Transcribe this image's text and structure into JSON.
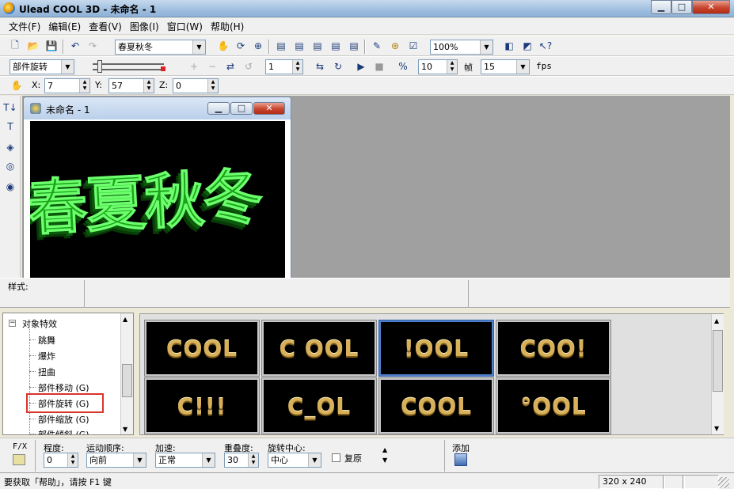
{
  "window": {
    "title": "Ulead COOL 3D - 未命名 - 1",
    "minimize": "▁",
    "maximize": "□",
    "close": "✕"
  },
  "menubar": [
    "文件(F)",
    "编辑(E)",
    "查看(V)",
    "图像(I)",
    "窗口(W)",
    "帮助(H)"
  ],
  "toolbar1": {
    "text_object_combo": "春夏秋冬",
    "zoom_combo": "100%"
  },
  "toolbar2": {
    "object_combo": "部件旋转",
    "frame_value": "1",
    "total_frames_value": "10",
    "frames_label": "帧",
    "fps_value": "15",
    "fps_label": "fps"
  },
  "toolbar3": {
    "x_label": "X:",
    "x_value": "7",
    "y_label": "Y:",
    "y_value": "57",
    "z_label": "Z:",
    "z_value": "0"
  },
  "child_window": {
    "title": "未命名 - 1",
    "canvas_text": "春夏秋冬"
  },
  "style_panel": {
    "label": "样式:"
  },
  "tree": {
    "root_toggle": "−",
    "root": "对象特效",
    "items": [
      "跳舞",
      "爆炸",
      "扭曲",
      "部件移动 (G)",
      "部件旋转 (G)",
      "部件缩放 (G)",
      "部件倾斜 (G)"
    ]
  },
  "thumbnails": [
    "COOL",
    "C OOL",
    "!OOL",
    "COO!",
    "C!!!",
    "C_OL",
    "COOL",
    "°OOL"
  ],
  "props": {
    "fx_label": "F/X",
    "degree_label": "程度:",
    "degree_value": "0",
    "order_label": "运动顺序:",
    "order_value": "向前",
    "accel_label": "加速:",
    "accel_value": "正常",
    "overlap_label": "重叠度:",
    "overlap_value": "30",
    "center_label": "旋转中心:",
    "center_value": "中心",
    "restore_label": "复原",
    "add_label": "添加"
  },
  "statusbar": {
    "help_text": "要获取「帮助」，请按 F1 键",
    "size_text": "320 x 240"
  },
  "colors": {
    "canvas_text": "#22c022",
    "highlight_box": "#d9342b",
    "thumb_text": "#d8b05a"
  }
}
